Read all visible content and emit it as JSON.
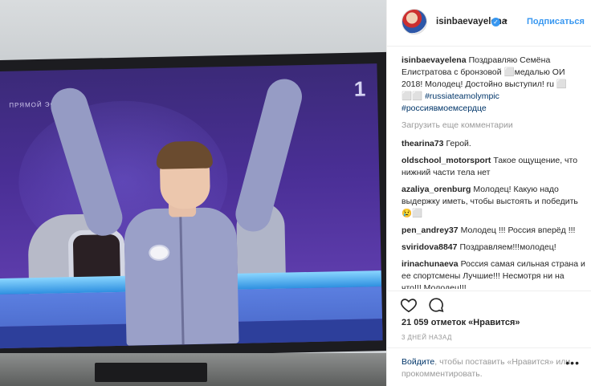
{
  "post": {
    "username": "isinbaevayelena",
    "follow_label": "Подписаться",
    "separator": "•",
    "verified_glyph": "✓"
  },
  "photo": {
    "live_label": "ПРЯМОЙ ЭФИР",
    "channel_logo": "1"
  },
  "caption": {
    "user": "isinbaevayelena",
    "text": "Поздравляю Семёна Елистратова с бронзовой ⬜медалью ОИ 2018! Молодец! Достойно выступил! ru ⬜ ⬜⬜",
    "tag1": "#russiateamolympic",
    "tag2": "#россиявмоемсердце"
  },
  "load_more": "Загрузить еще комментарии",
  "comments": [
    {
      "user": "thearina73",
      "text": "Герой."
    },
    {
      "user": "oldschool_motorsport",
      "text": "Такое ощущение, что нижний части тела нет"
    },
    {
      "user": "azaliya_orenburg",
      "text": "Молодец! Какую надо выдержку иметь, чтобы выстоять и победить😢⬜"
    },
    {
      "user": "pen_andrey37",
      "text": "Молодец !!! Россия вперёд !!!"
    },
    {
      "user": "sviridova8847",
      "text": "Поздравляем!!!молодец!"
    },
    {
      "user": "irinachunaeva",
      "text": "Россия самая сильная страна и ее спортсмены Лучшие!!! Несмотря ни на что!!! Молодец!!!"
    }
  ],
  "actions": {
    "like_icon": "heart-icon",
    "comment_icon": "comment-icon"
  },
  "likes_text": "21 059 отметок «Нравится»",
  "time_ago": "3 ДНЕЙ НАЗАД",
  "add_comment": {
    "login_link": "Войдите",
    "rest": ", чтобы поставить «Нравится» или прокомментировать.",
    "more": "•••"
  },
  "colors": {
    "accent": "#3897f0",
    "link": "#003569",
    "muted": "#999999",
    "screen_purple": "#4a2f96"
  }
}
